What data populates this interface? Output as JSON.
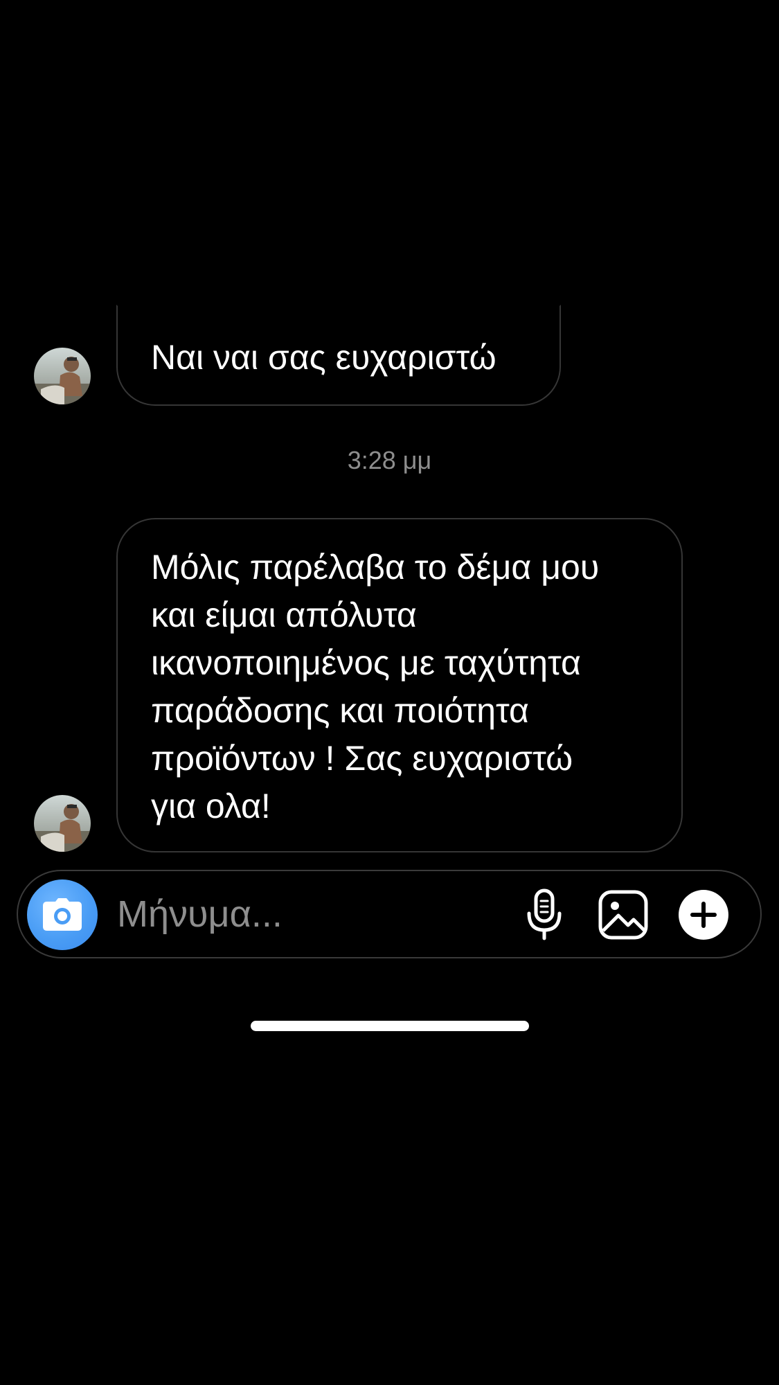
{
  "thread": {
    "messages": [
      {
        "text": "Ναι ναι σας ευχαριστώ"
      },
      {
        "lines": [
          "Μόλις παρέλαβα το δέμα μου",
          "και είμαι απόλυτα",
          "ικανοποιημένος με ταχύτητα",
          "παράδοσης και ποιότητα",
          "προϊόντων ! Σας ευχαριστώ",
          "για ολα!"
        ]
      }
    ],
    "timestamp": "3:28 μμ"
  },
  "composer": {
    "placeholder": "Μήνυμα...",
    "icons": [
      "camera-icon",
      "microphone-icon",
      "gallery-icon",
      "plus-icon"
    ],
    "accent_color": "#4a9df5"
  },
  "colors": {
    "background": "#000000",
    "bubble_border": "#363636",
    "timestamp": "#8e8e8e"
  }
}
